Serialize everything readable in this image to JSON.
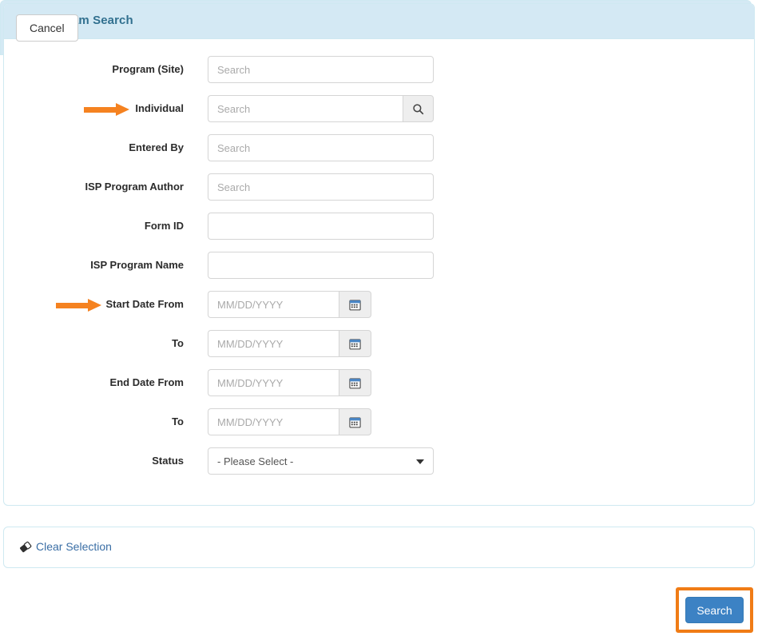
{
  "panel": {
    "title": "ISP Program Search"
  },
  "form": {
    "rows": [
      {
        "label": "Program (Site)",
        "type": "search-text",
        "placeholder": "Search",
        "value": "",
        "arrow": false
      },
      {
        "label": "Individual",
        "type": "search-btn",
        "placeholder": "Search",
        "value": "",
        "arrow": true
      },
      {
        "label": "Entered By",
        "type": "search-text",
        "placeholder": "Search",
        "value": "",
        "arrow": false
      },
      {
        "label": "ISP Program Author",
        "type": "search-text",
        "placeholder": "Search",
        "value": "",
        "arrow": false
      },
      {
        "label": "Form ID",
        "type": "text",
        "placeholder": "",
        "value": "",
        "arrow": false
      },
      {
        "label": "ISP Program Name",
        "type": "text",
        "placeholder": "",
        "value": "",
        "arrow": false
      },
      {
        "label": "Start Date From",
        "type": "date",
        "placeholder": "MM/DD/YYYY",
        "value": "",
        "arrow": true
      },
      {
        "label": "To",
        "type": "date",
        "placeholder": "MM/DD/YYYY",
        "value": "",
        "arrow": false
      },
      {
        "label": "End Date From",
        "type": "date",
        "placeholder": "MM/DD/YYYY",
        "value": "",
        "arrow": false
      },
      {
        "label": "To",
        "type": "date",
        "placeholder": "MM/DD/YYYY",
        "value": "",
        "arrow": false
      },
      {
        "label": "Status",
        "type": "select",
        "placeholder": "",
        "value": "- Please Select -",
        "arrow": false
      }
    ]
  },
  "status_options": [
    "- Please Select -"
  ],
  "clear": {
    "label": "Clear Selection",
    "icon": "eraser-icon"
  },
  "footer": {
    "cancel_label": "Cancel",
    "search_label": "Search"
  },
  "icons": {
    "search": "search-icon",
    "calendar": "calendar-icon",
    "caret": "chevron-down-icon"
  },
  "colors": {
    "header_bg": "#d4e9f4",
    "header_text": "#31708f",
    "panel_border": "#cfe9f1",
    "accent_orange": "#f58220",
    "highlight_orange": "#f07c16",
    "primary_button": "#3c82c4",
    "link": "#3a6ea5"
  }
}
